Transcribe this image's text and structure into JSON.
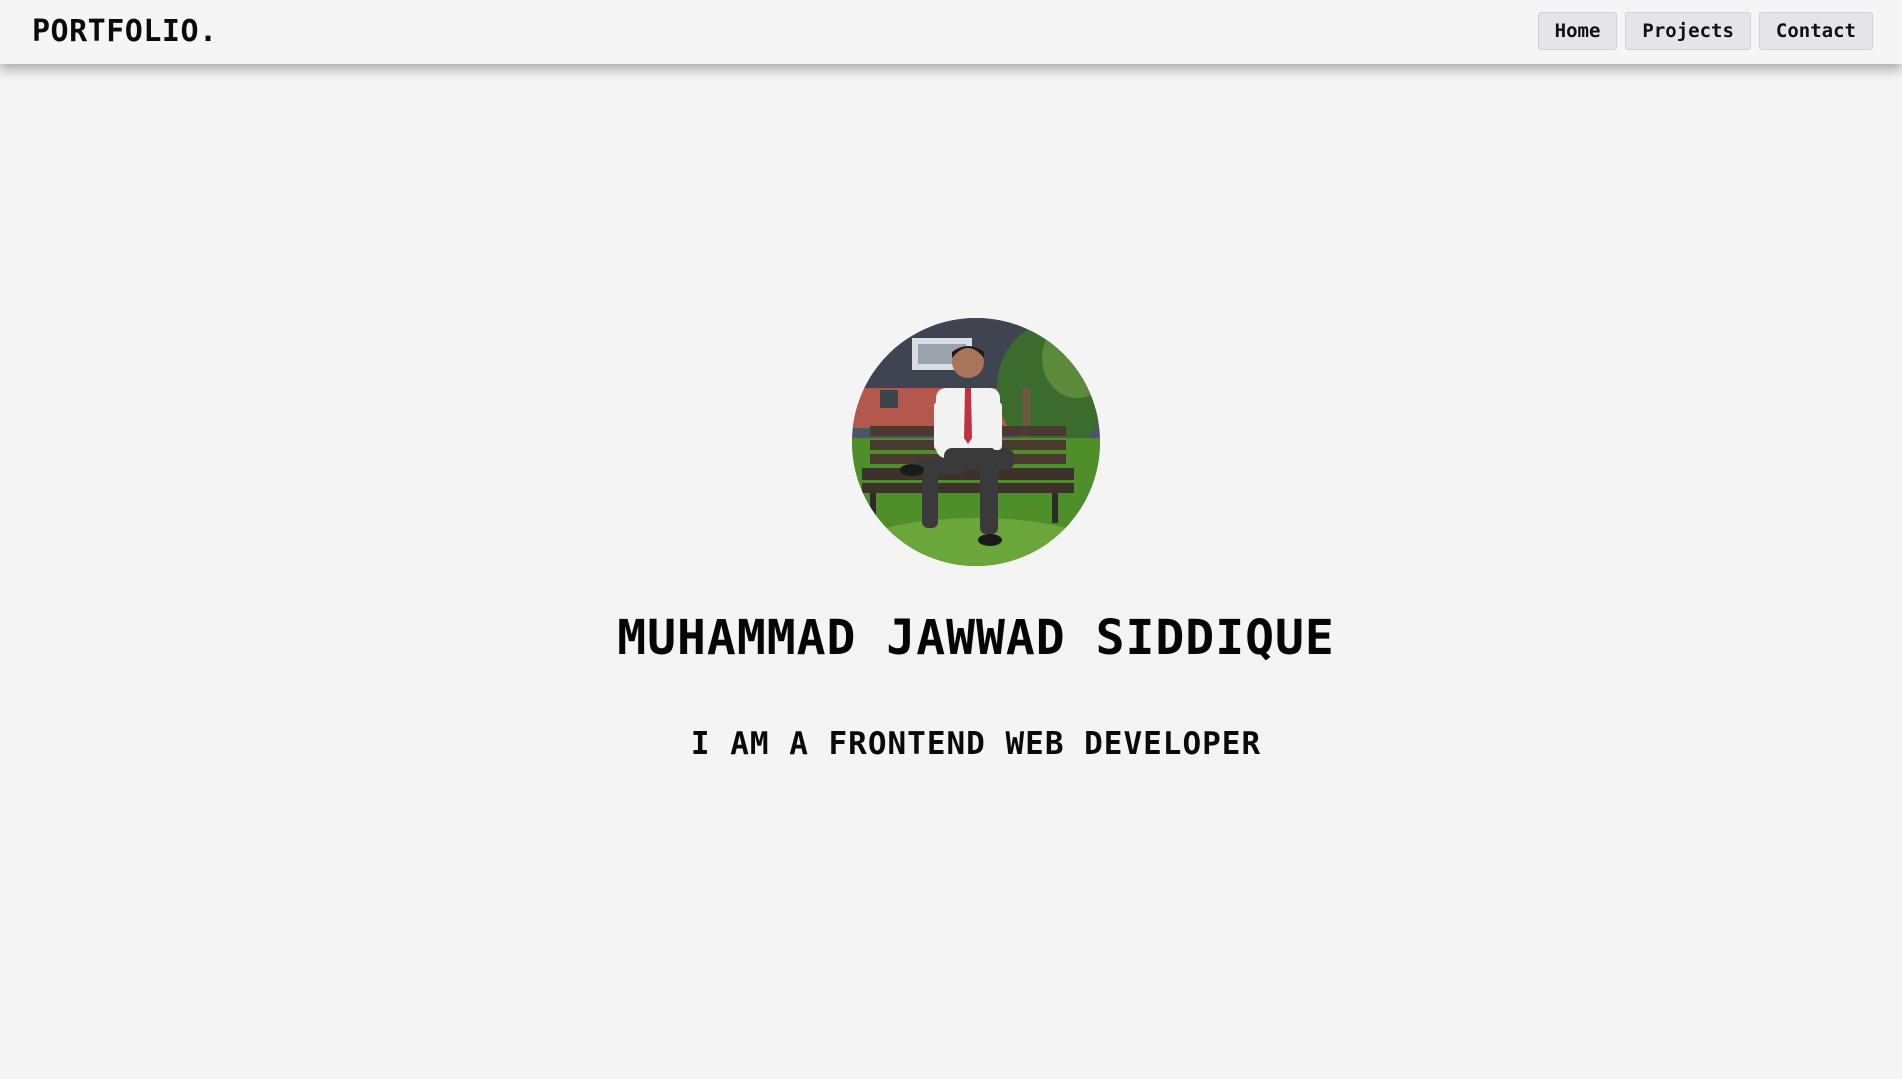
{
  "navbar": {
    "brand": "PORTFOLIO.",
    "links": [
      {
        "label": "Home"
      },
      {
        "label": "Projects"
      },
      {
        "label": "Contact"
      }
    ]
  },
  "hero": {
    "name": "MUHAMMAD JAWWAD SIDDIQUE",
    "tagline": "I AM A FRONTEND WEB DEVELOPER",
    "avatar_icon": "profile-photo"
  },
  "colors": {
    "background": "#f4f4f4",
    "navbar": "#f5f5f5",
    "button": "#e5e5e7",
    "text": "#0a0a0a"
  }
}
